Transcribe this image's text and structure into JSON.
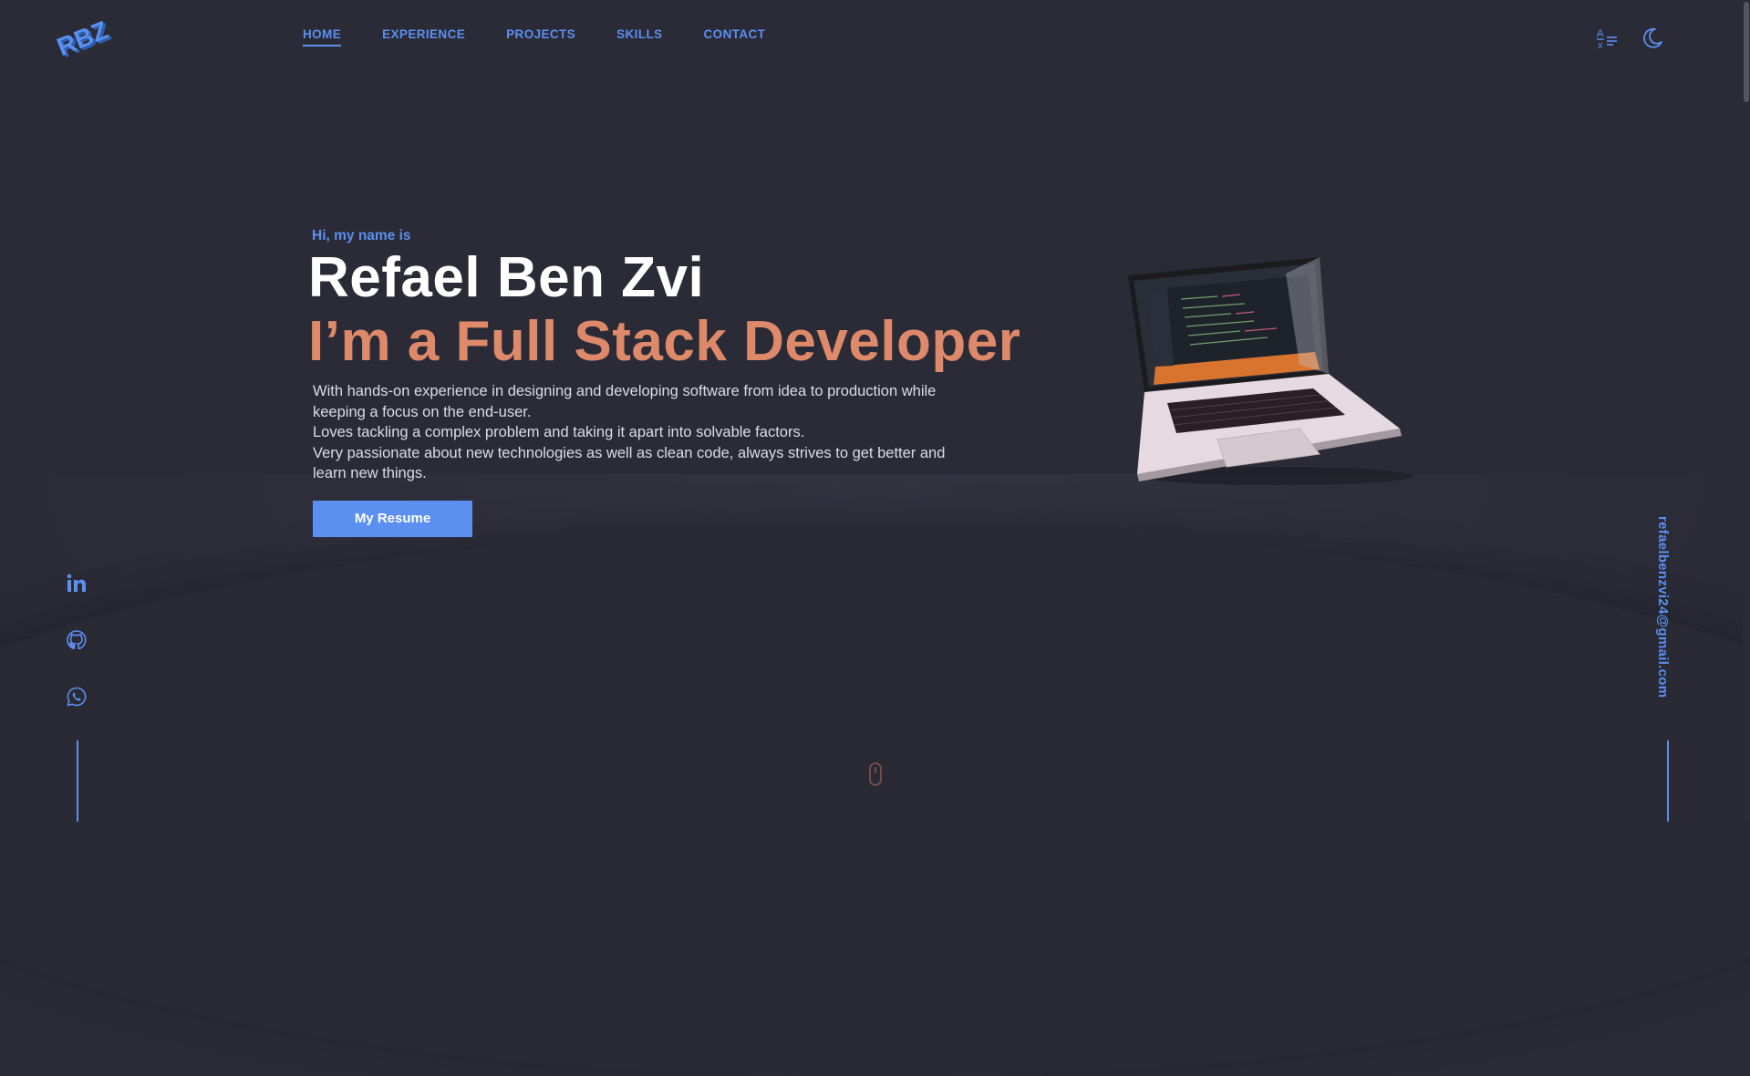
{
  "header": {
    "logo_text": "RBZ",
    "nav": [
      {
        "label": "HOME",
        "active": true
      },
      {
        "label": "EXPERIENCE",
        "active": false
      },
      {
        "label": "PROJECTS",
        "active": false
      },
      {
        "label": "SKILLS",
        "active": false
      },
      {
        "label": "CONTACT",
        "active": false
      }
    ],
    "icons": [
      "translate-icon",
      "moon-icon"
    ]
  },
  "hero": {
    "greeting": "Hi, my name is",
    "name": "Refael Ben Zvi",
    "role": "I’m a Full Stack Developer",
    "description": [
      "With hands-on experience in designing and developing software from idea to production while keeping a focus on the end-user.",
      "Loves tackling a complex problem and taking it apart into solvable factors.",
      "Very passionate about new technologies as well as clean code, always strives to get better and learn new things."
    ],
    "resume_button": "My Resume"
  },
  "socials": [
    "linkedin-icon",
    "github-icon",
    "whatsapp-icon"
  ],
  "email": "refaelbenzvi24@gmail.com",
  "colors": {
    "background": "#2b2b37",
    "accent": "#5b8ff0",
    "role": "#de8a6a",
    "text": "#dcdce4"
  }
}
